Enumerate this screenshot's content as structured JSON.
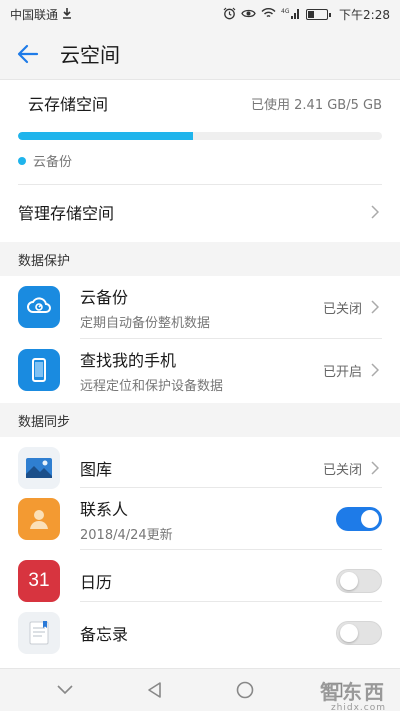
{
  "status_bar": {
    "carrier": "中国联通",
    "time": "下午2:28",
    "signal": "4G",
    "icons": [
      "download-icon",
      "alarm-icon",
      "eye-icon",
      "wifi-icon",
      "signal-icon",
      "battery-icon"
    ]
  },
  "header": {
    "title": "云空间",
    "back_icon": "back-arrow-icon"
  },
  "storage": {
    "title": "云存储空间",
    "used_text": "已使用 2.41 GB/5 GB",
    "used_fraction": 0.482,
    "legend_label": "云备份",
    "accent_color": "#1fb4ec"
  },
  "manage": {
    "label": "管理存储空间"
  },
  "sections": {
    "protection": "数据保护",
    "sync": "数据同步"
  },
  "protection_items": [
    {
      "title": "云备份",
      "subtitle": "定期自动备份整机数据",
      "status": "已关闭",
      "icon": "cloud-backup-icon"
    },
    {
      "title": "查找我的手机",
      "subtitle": "远程定位和保护设备数据",
      "status": "已开启",
      "icon": "find-phone-icon"
    }
  ],
  "sync_items": [
    {
      "title": "图库",
      "subtitle": "",
      "status": "已关闭",
      "icon": "gallery-icon"
    },
    {
      "title": "联系人",
      "subtitle": "2018/4/24更新",
      "toggle": true,
      "icon": "contacts-icon"
    },
    {
      "title": "日历",
      "subtitle": "",
      "toggle": false,
      "icon": "calendar-icon",
      "icon_text": "31"
    },
    {
      "title": "备忘录",
      "subtitle": "",
      "toggle": false,
      "icon": "notes-icon"
    }
  ],
  "watermark": {
    "main": "智东西",
    "sub": "zhidx.com"
  },
  "colors": {
    "toggle_on": "#1e7be8",
    "cloud_icon_bg": "#1a8be0",
    "contacts_icon_bg": "#f39a32",
    "calendar_icon_bg": "#d7343f"
  }
}
